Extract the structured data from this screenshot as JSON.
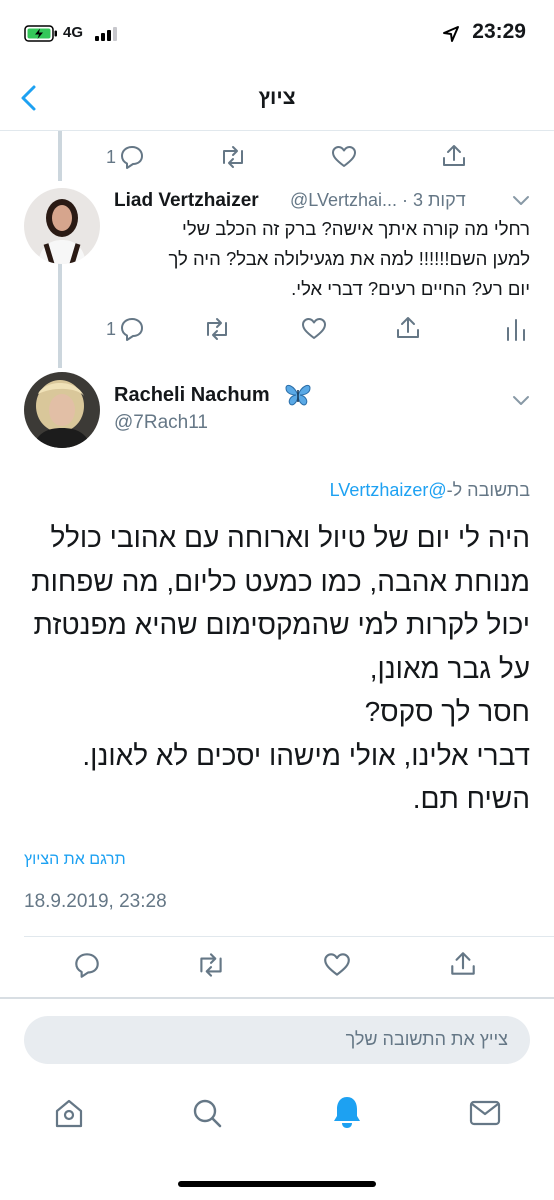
{
  "status_bar": {
    "network": "4G",
    "time": "23:29"
  },
  "nav": {
    "title": "ציוץ"
  },
  "thread": {
    "prev_reply_count": "1",
    "reply": {
      "display_name": "Liad Vertzhaizer",
      "meta": "@LVertzhai... · 3 דקות",
      "lines": [
        "רחלי מה קורה איתך אישה? ברק זה הכלב שלי",
        "למען השם!!!!!! למה את מגעילולה אבל? היה לך",
        "יום רע? החיים רעים? דברי אלי."
      ],
      "reply_count": "1"
    }
  },
  "main_tweet": {
    "display_name": "Racheli Nachum",
    "handle": "@7Rach11",
    "replying_prefix": "בתשובה ל-",
    "replying_handle": "@LVertzhaizer",
    "lines": [
      "היה לי יום של טיול וארוחה עם אהובי כולל",
      "מנוחת אהבה, כמו כמעט כליום, מה שפחות",
      "יכול לקרות למי שהמקסימום שהיא מפנטזת",
      "על גבר מאונן,",
      "חסר לך סקס?",
      "דברי אלינו, אולי מישהו יסכים לא לאונן.",
      "השיח תם."
    ],
    "translate": "תרגם את הציוץ",
    "timestamp": "18.9.2019, 23:28"
  },
  "composer": {
    "placeholder": "צייץ את התשובה שלך"
  },
  "colors": {
    "accent": "#1da1f2",
    "text": "#14171a",
    "muted": "#657786"
  }
}
